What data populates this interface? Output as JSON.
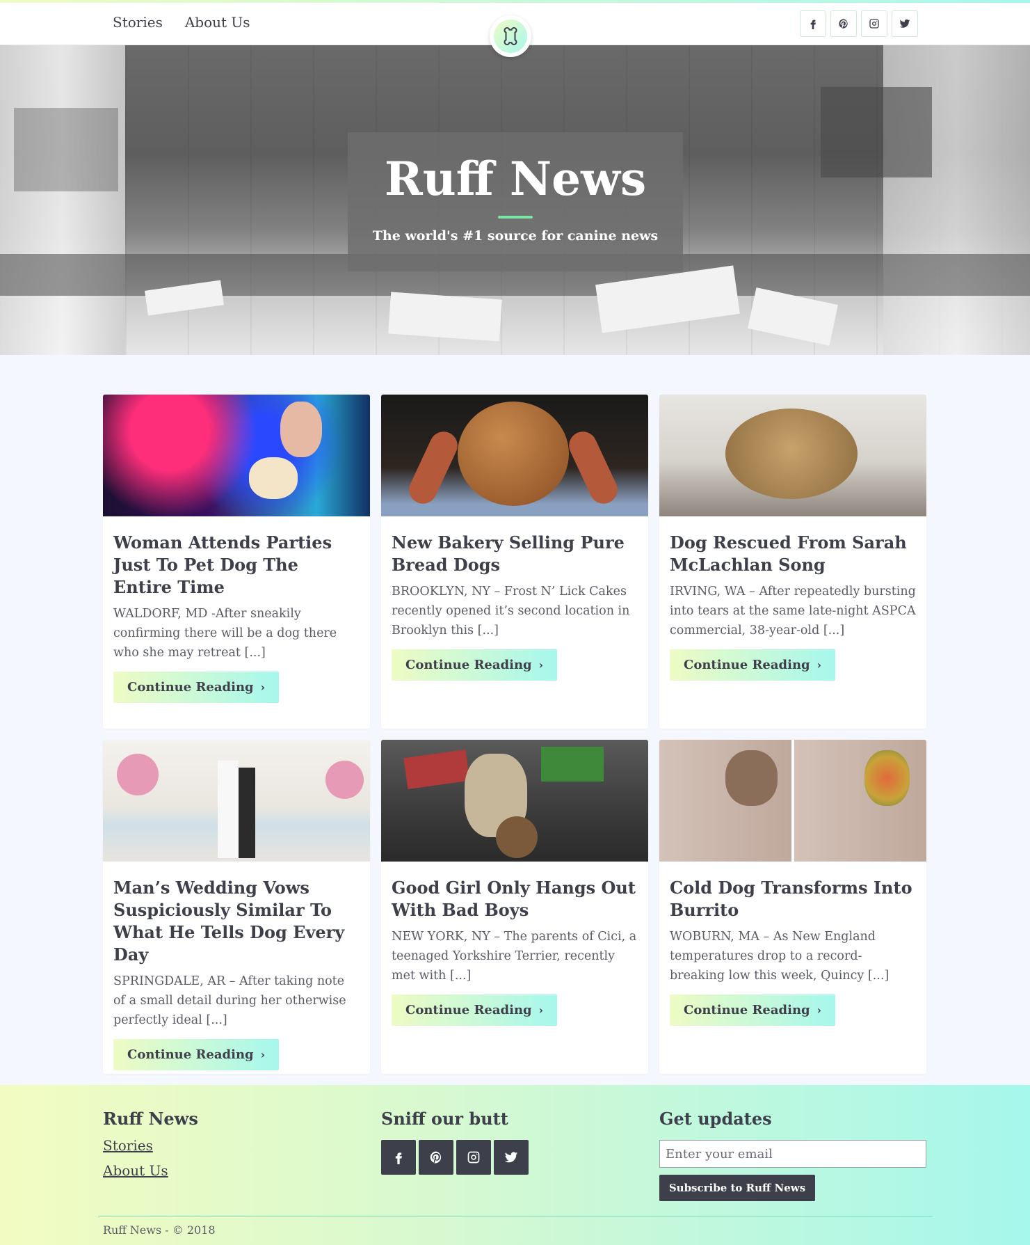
{
  "nav": {
    "links": [
      "Stories",
      "About Us"
    ]
  },
  "hero": {
    "title": "Ruff News",
    "subtitle": "The world's #1 source for canine news"
  },
  "cards": [
    {
      "title": "Woman Attends Parties Just To Pet Dog The Entire Time",
      "excerpt": "WALDORF, MD -After sneakily confirming there will be a dog there who she may retreat [...]",
      "button": "Continue Reading"
    },
    {
      "title": "New Bakery Selling Pure Bread Dogs",
      "excerpt": "BROOKLYN, NY – Frost N’ Lick Cakes recently opened it’s second location in Brooklyn this [...]",
      "button": "Continue Reading"
    },
    {
      "title": "Dog Rescued From Sarah McLachlan Song",
      "excerpt": "IRVING, WA – After repeatedly bursting into tears at the same late-night ASPCA commercial, 38-year-old [...]",
      "button": "Continue Reading"
    },
    {
      "title": "Man’s Wedding Vows Suspiciously Similar To What He Tells Dog Every Day",
      "excerpt": "SPRINGDALE, AR – After taking note of a small detail during her otherwise perfectly ideal [...]",
      "button": "Continue Reading"
    },
    {
      "title": "Good Girl Only Hangs Out With Bad Boys",
      "excerpt": "NEW YORK, NY – The parents of Cici, a teenaged Yorkshire Terrier, recently met with [...]",
      "button": "Continue Reading"
    },
    {
      "title": "Cold Dog Transforms Into Burrito",
      "excerpt": "WOBURN, MA – As New England temperatures drop to a record-breaking low this week, Quincy [...]",
      "button": "Continue Reading"
    }
  ],
  "footer": {
    "brand": "Ruff News",
    "links": [
      "Stories",
      "About Us"
    ],
    "social_heading": "Sniff our butt",
    "updates_heading": "Get updates",
    "email_placeholder": "Enter your email",
    "subscribe_label": "Subscribe to Ruff News",
    "copyright": "Ruff News - © 2018"
  },
  "social_icons": [
    "facebook-icon",
    "pinterest-icon",
    "instagram-icon",
    "twitter-icon"
  ],
  "colors": {
    "accent_gradient_start": "#eefbc4",
    "accent_gradient_end": "#a6f7ec",
    "dark": "#3d3f4a",
    "hero_rule": "#7de3a7"
  }
}
